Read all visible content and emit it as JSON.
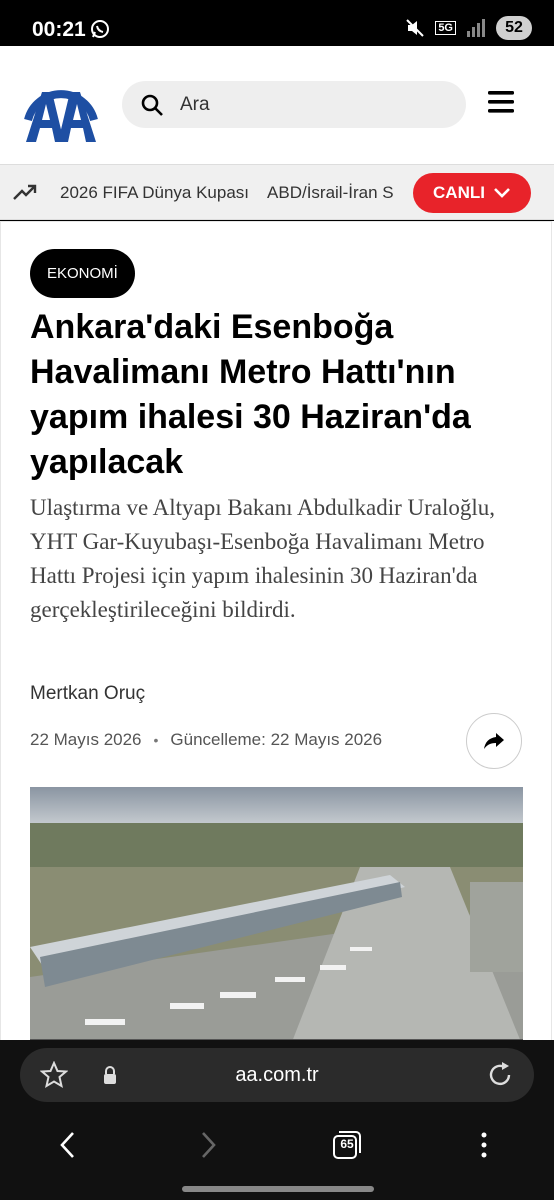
{
  "status_bar": {
    "time": "00:21",
    "network": "5G",
    "battery": "52"
  },
  "search": {
    "placeholder": "Ara"
  },
  "trending": {
    "items": [
      "2026 FIFA Dünya Kupası",
      "ABD/İsrail-İran S"
    ],
    "live_label": "CANLI"
  },
  "article": {
    "category": "EKONOMİ",
    "headline": "Ankara'daki Esenboğa Havalimanı Metro Hattı'nın yapım ihalesi 30 Haziran'da yapılacak",
    "summary": "Ulaştırma ve Altyapı Bakanı Abdulkadir Uraloğlu, YHT Gar-Kuyubaşı-Esenboğa Havalimanı Metro Hattı Projesi için yapım ihalesinin 30 Haziran'da gerçekleştirileceğini bildirdi.",
    "author": "Mertkan Oruç",
    "date": "22 Mayıs 2026",
    "updated": "Güncelleme: 22 Mayıs 2026"
  },
  "browser": {
    "url": "aa.com.tr",
    "tab_count": "65"
  },
  "colors": {
    "accent": "#e8232a",
    "logo": "#1e4fa3"
  }
}
